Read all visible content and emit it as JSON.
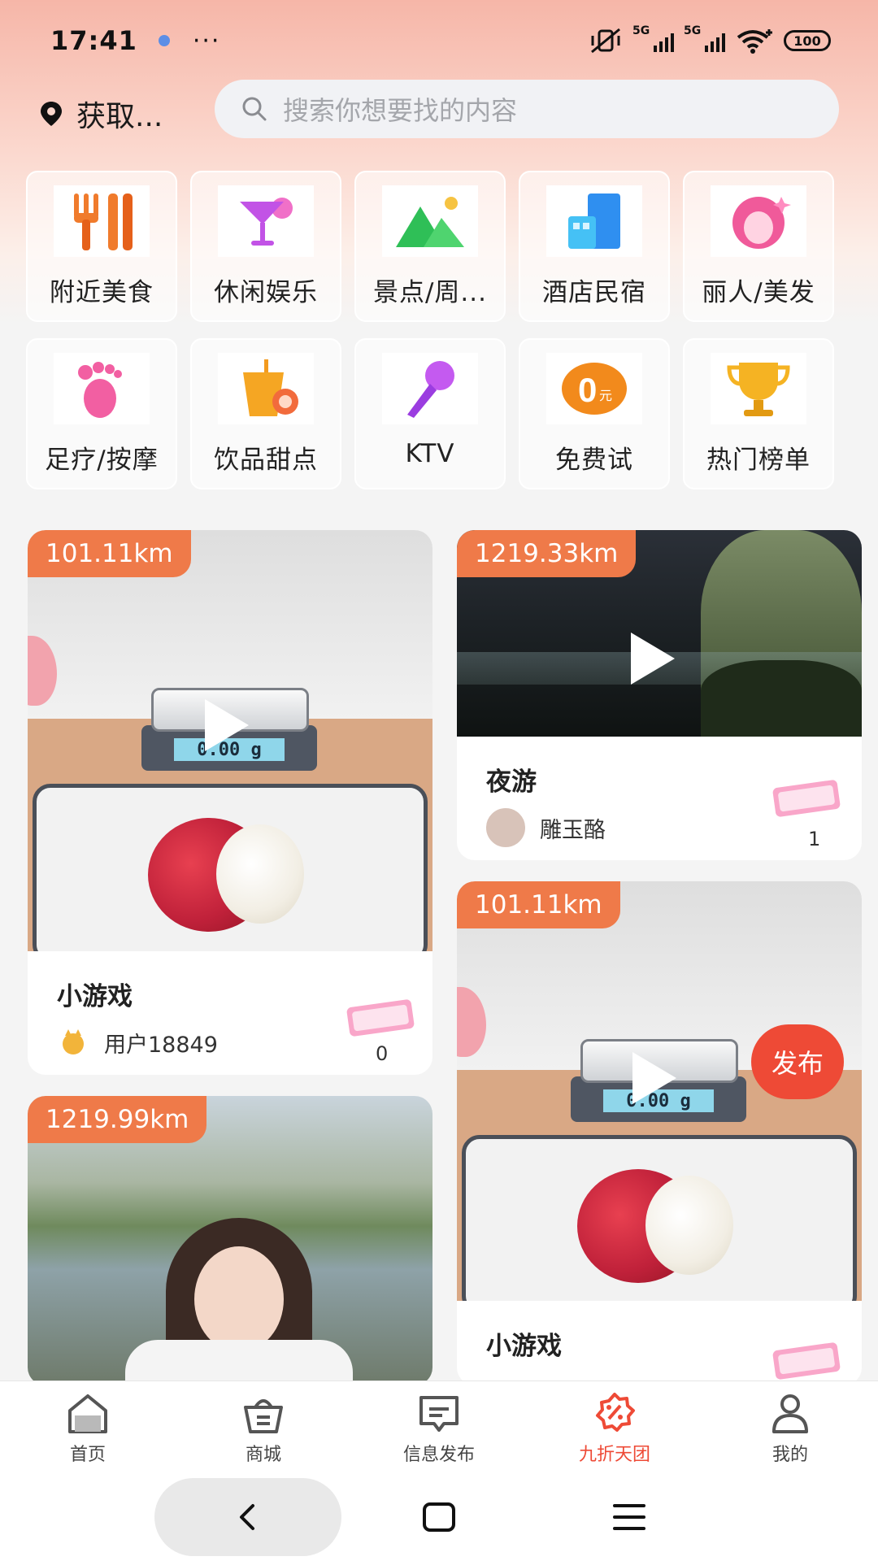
{
  "status_bar": {
    "time": "17:41",
    "more": "···",
    "net1": "5G",
    "net2": "5G",
    "battery": "100"
  },
  "header": {
    "location": "获取...",
    "search_placeholder": "搜索你想要找的内容"
  },
  "categories": [
    {
      "label": "附近美食",
      "icon": "cutlery-icon"
    },
    {
      "label": "休闲娱乐",
      "icon": "cocktail-icon"
    },
    {
      "label": "景点/周...",
      "icon": "mountain-icon"
    },
    {
      "label": "酒店民宿",
      "icon": "building-icon"
    },
    {
      "label": "丽人/美发",
      "icon": "beauty-face-icon"
    },
    {
      "label": "足疗/按摩",
      "icon": "footprint-icon"
    },
    {
      "label": "饮品甜点",
      "icon": "drink-dessert-icon"
    },
    {
      "label": "KTV",
      "icon": "microphone-icon"
    },
    {
      "label": "免费试",
      "icon": "zero-yuan-icon"
    },
    {
      "label": "热门榜单",
      "icon": "trophy-icon"
    }
  ],
  "feed": [
    {
      "distance": "101.11km",
      "title": "小游戏",
      "author": "用户18849",
      "count": "0"
    },
    {
      "distance": "1219.33km",
      "title": "夜游",
      "author": "雕玉酪",
      "count": "1"
    },
    {
      "distance": "101.11km",
      "title": "小游戏",
      "author": "",
      "count": ""
    },
    {
      "distance": "1219.99km",
      "title": "",
      "author": "",
      "count": ""
    }
  ],
  "scale_reading": "0.00 g",
  "publish_label": "发布",
  "tabs": [
    {
      "label": "首页",
      "icon": "home-icon"
    },
    {
      "label": "商城",
      "icon": "shopping-basket-icon"
    },
    {
      "label": "信息发布",
      "icon": "message-icon"
    },
    {
      "label": "九折天团",
      "icon": "discount-badge-icon"
    },
    {
      "label": "我的",
      "icon": "profile-icon"
    }
  ],
  "active_tab": "九折天团",
  "colors": {
    "accent": "#ee4a36",
    "distance_tag": "#ef7a49"
  }
}
